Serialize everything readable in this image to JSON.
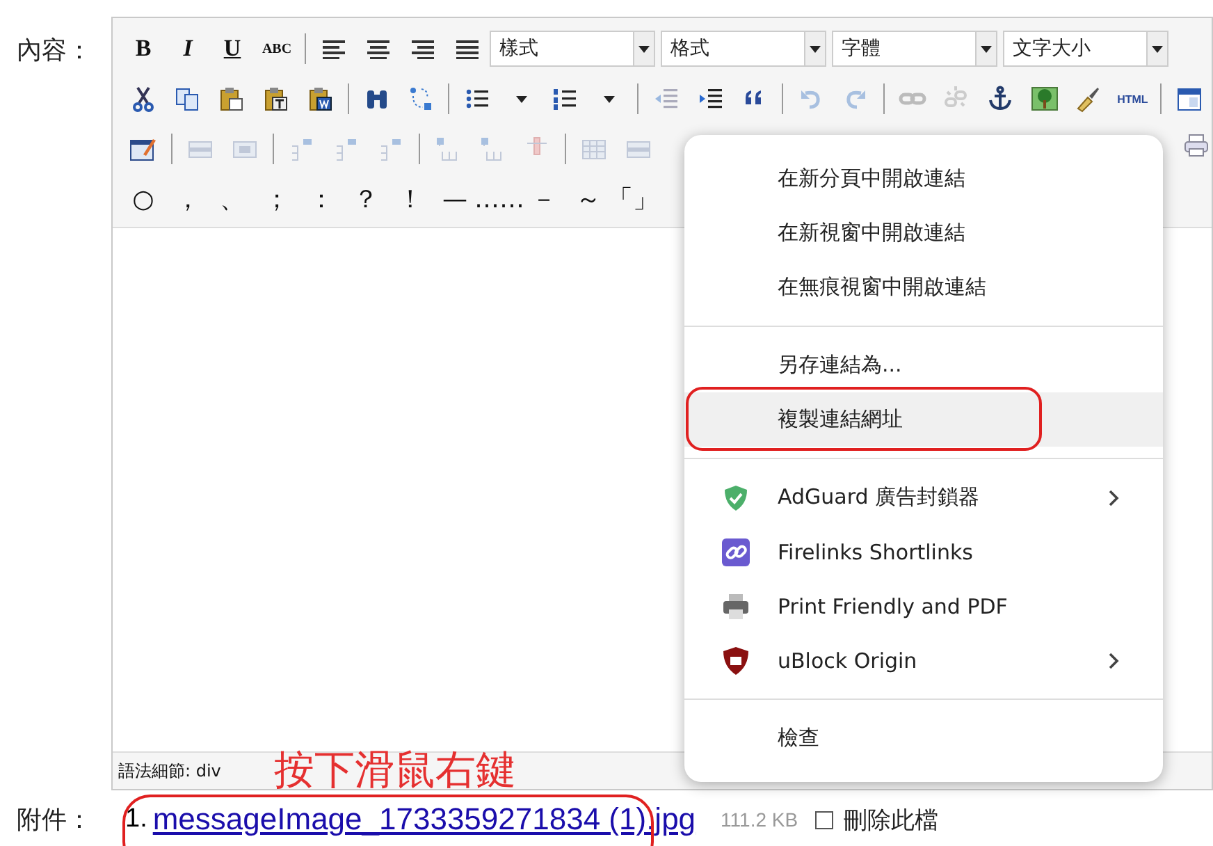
{
  "field_label": "內容：",
  "toolbar": {
    "format_buttons": [
      {
        "label": "B",
        "kind": "bold"
      },
      {
        "label": "I",
        "kind": "italic"
      },
      {
        "label": "U",
        "kind": "underline"
      },
      {
        "label": "ABC",
        "kind": "strike"
      }
    ],
    "dropdowns": [
      "樣式",
      "格式",
      "字體",
      "文字大小"
    ],
    "html_button": "HTML",
    "symbols": [
      "○",
      "，",
      "、",
      "；",
      "：",
      "？",
      "！",
      "—",
      "……",
      "－",
      "～",
      "「」"
    ]
  },
  "status_bar": "語法細節: div",
  "annotation": "按下滑鼠右鍵",
  "attachment": {
    "label": "附件：",
    "index": "1.",
    "file": "messageImage_1733359271834 (1).jpg",
    "size": "111.2 KB",
    "delete": {
      "label": "刪除此檔",
      "checked": false
    }
  },
  "context_menu": [
    {
      "kind": "item",
      "label": "在新分頁中開啟連結",
      "selected": false
    },
    {
      "kind": "item",
      "label": "在新視窗中開啟連結",
      "selected": false
    },
    {
      "kind": "item",
      "label": "在無痕視窗中開啟連結",
      "selected": false
    },
    {
      "kind": "separator"
    },
    {
      "kind": "item",
      "label": "另存連結為...",
      "selected": false
    },
    {
      "kind": "item",
      "label": "複製連結網址",
      "selected": true,
      "circled": true
    },
    {
      "kind": "separator"
    },
    {
      "kind": "extension",
      "label": "AdGuard 廣告封鎖器",
      "submenu": true,
      "selected": false
    },
    {
      "kind": "extension",
      "label": "Firelinks Shortlinks",
      "submenu": false,
      "selected": false
    },
    {
      "kind": "extension",
      "label": "Print Friendly and PDF",
      "submenu": false,
      "selected": false
    },
    {
      "kind": "extension",
      "label": "uBlock Origin",
      "submenu": true,
      "selected": false
    },
    {
      "kind": "separator"
    },
    {
      "kind": "item",
      "label": "檢查",
      "selected": false
    }
  ]
}
